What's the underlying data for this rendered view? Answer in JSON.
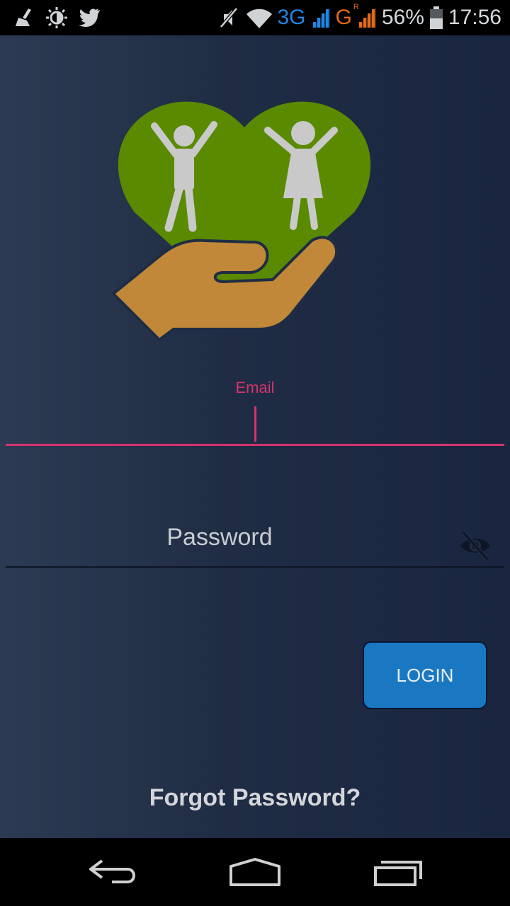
{
  "status_bar": {
    "network_3g": "3G",
    "network_g": "G",
    "roaming": "R",
    "battery": "56%",
    "time": "17:56"
  },
  "form": {
    "email_label": "Email",
    "email_value": "",
    "password_placeholder": "Password",
    "login_label": "LOGIN",
    "forgot_label": "Forgot Password?"
  },
  "colors": {
    "accent": "#d6336c",
    "button": "#1a78c2",
    "heart": "#5a8a00",
    "hand": "#c08838"
  },
  "icons": {
    "status": [
      "broom-icon",
      "brightness-icon",
      "twitter-icon",
      "mute-icon",
      "wifi-icon",
      "signal-icon",
      "battery-icon"
    ],
    "password_toggle": "eye-off-icon",
    "nav": [
      "back-icon",
      "home-icon",
      "recents-icon"
    ]
  }
}
